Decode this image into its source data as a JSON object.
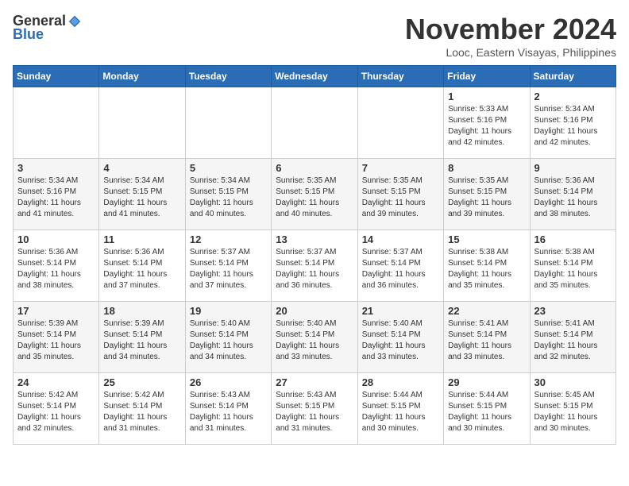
{
  "header": {
    "logo_general": "General",
    "logo_blue": "Blue",
    "month_title": "November 2024",
    "location": "Looc, Eastern Visayas, Philippines"
  },
  "days_of_week": [
    "Sunday",
    "Monday",
    "Tuesday",
    "Wednesday",
    "Thursday",
    "Friday",
    "Saturday"
  ],
  "weeks": [
    [
      {
        "day": "",
        "info": ""
      },
      {
        "day": "",
        "info": ""
      },
      {
        "day": "",
        "info": ""
      },
      {
        "day": "",
        "info": ""
      },
      {
        "day": "",
        "info": ""
      },
      {
        "day": "1",
        "info": "Sunrise: 5:33 AM\nSunset: 5:16 PM\nDaylight: 11 hours and 42 minutes."
      },
      {
        "day": "2",
        "info": "Sunrise: 5:34 AM\nSunset: 5:16 PM\nDaylight: 11 hours and 42 minutes."
      }
    ],
    [
      {
        "day": "3",
        "info": "Sunrise: 5:34 AM\nSunset: 5:16 PM\nDaylight: 11 hours and 41 minutes."
      },
      {
        "day": "4",
        "info": "Sunrise: 5:34 AM\nSunset: 5:15 PM\nDaylight: 11 hours and 41 minutes."
      },
      {
        "day": "5",
        "info": "Sunrise: 5:34 AM\nSunset: 5:15 PM\nDaylight: 11 hours and 40 minutes."
      },
      {
        "day": "6",
        "info": "Sunrise: 5:35 AM\nSunset: 5:15 PM\nDaylight: 11 hours and 40 minutes."
      },
      {
        "day": "7",
        "info": "Sunrise: 5:35 AM\nSunset: 5:15 PM\nDaylight: 11 hours and 39 minutes."
      },
      {
        "day": "8",
        "info": "Sunrise: 5:35 AM\nSunset: 5:15 PM\nDaylight: 11 hours and 39 minutes."
      },
      {
        "day": "9",
        "info": "Sunrise: 5:36 AM\nSunset: 5:14 PM\nDaylight: 11 hours and 38 minutes."
      }
    ],
    [
      {
        "day": "10",
        "info": "Sunrise: 5:36 AM\nSunset: 5:14 PM\nDaylight: 11 hours and 38 minutes."
      },
      {
        "day": "11",
        "info": "Sunrise: 5:36 AM\nSunset: 5:14 PM\nDaylight: 11 hours and 37 minutes."
      },
      {
        "day": "12",
        "info": "Sunrise: 5:37 AM\nSunset: 5:14 PM\nDaylight: 11 hours and 37 minutes."
      },
      {
        "day": "13",
        "info": "Sunrise: 5:37 AM\nSunset: 5:14 PM\nDaylight: 11 hours and 36 minutes."
      },
      {
        "day": "14",
        "info": "Sunrise: 5:37 AM\nSunset: 5:14 PM\nDaylight: 11 hours and 36 minutes."
      },
      {
        "day": "15",
        "info": "Sunrise: 5:38 AM\nSunset: 5:14 PM\nDaylight: 11 hours and 35 minutes."
      },
      {
        "day": "16",
        "info": "Sunrise: 5:38 AM\nSunset: 5:14 PM\nDaylight: 11 hours and 35 minutes."
      }
    ],
    [
      {
        "day": "17",
        "info": "Sunrise: 5:39 AM\nSunset: 5:14 PM\nDaylight: 11 hours and 35 minutes."
      },
      {
        "day": "18",
        "info": "Sunrise: 5:39 AM\nSunset: 5:14 PM\nDaylight: 11 hours and 34 minutes."
      },
      {
        "day": "19",
        "info": "Sunrise: 5:40 AM\nSunset: 5:14 PM\nDaylight: 11 hours and 34 minutes."
      },
      {
        "day": "20",
        "info": "Sunrise: 5:40 AM\nSunset: 5:14 PM\nDaylight: 11 hours and 33 minutes."
      },
      {
        "day": "21",
        "info": "Sunrise: 5:40 AM\nSunset: 5:14 PM\nDaylight: 11 hours and 33 minutes."
      },
      {
        "day": "22",
        "info": "Sunrise: 5:41 AM\nSunset: 5:14 PM\nDaylight: 11 hours and 33 minutes."
      },
      {
        "day": "23",
        "info": "Sunrise: 5:41 AM\nSunset: 5:14 PM\nDaylight: 11 hours and 32 minutes."
      }
    ],
    [
      {
        "day": "24",
        "info": "Sunrise: 5:42 AM\nSunset: 5:14 PM\nDaylight: 11 hours and 32 minutes."
      },
      {
        "day": "25",
        "info": "Sunrise: 5:42 AM\nSunset: 5:14 PM\nDaylight: 11 hours and 31 minutes."
      },
      {
        "day": "26",
        "info": "Sunrise: 5:43 AM\nSunset: 5:14 PM\nDaylight: 11 hours and 31 minutes."
      },
      {
        "day": "27",
        "info": "Sunrise: 5:43 AM\nSunset: 5:15 PM\nDaylight: 11 hours and 31 minutes."
      },
      {
        "day": "28",
        "info": "Sunrise: 5:44 AM\nSunset: 5:15 PM\nDaylight: 11 hours and 30 minutes."
      },
      {
        "day": "29",
        "info": "Sunrise: 5:44 AM\nSunset: 5:15 PM\nDaylight: 11 hours and 30 minutes."
      },
      {
        "day": "30",
        "info": "Sunrise: 5:45 AM\nSunset: 5:15 PM\nDaylight: 11 hours and 30 minutes."
      }
    ]
  ]
}
